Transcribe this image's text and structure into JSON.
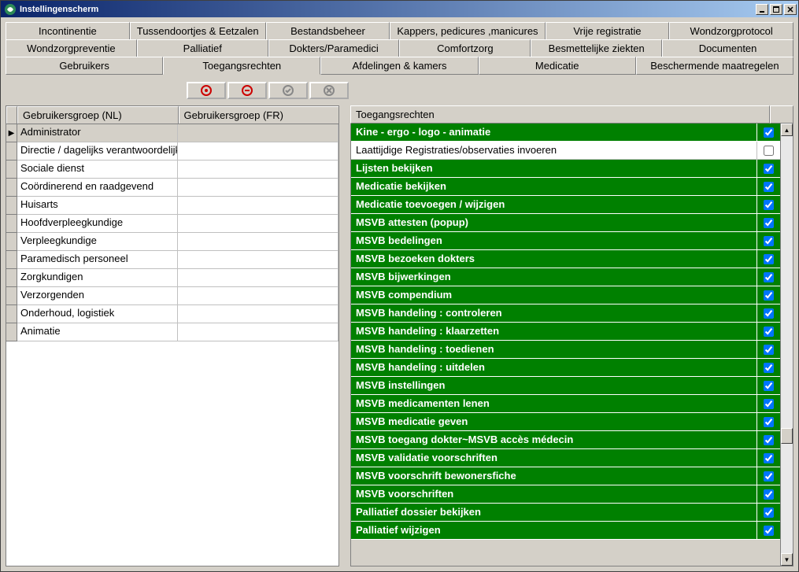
{
  "window": {
    "title": "Instellingenscherm"
  },
  "tabs_row1": [
    "Incontinentie",
    "Tussendoortjes & Eetzalen",
    "Bestandsbeheer",
    "Kappers, pedicures ,manicures",
    "Vrije registratie",
    "Wondzorgprotocol"
  ],
  "tabs_row2": [
    "Wondzorgpreventie",
    "Palliatief",
    "Dokters/Paramedici",
    "Comfortzorg",
    "Besmettelijke ziekten",
    "Documenten"
  ],
  "tabs_row3": [
    "Gebruikers",
    "Toegangsrechten",
    "Afdelingen & kamers",
    "Medicatie",
    "Beschermende maatregelen"
  ],
  "active_tab": "Toegangsrechten",
  "grid": {
    "headers": {
      "nl": "Gebruikersgroep (NL)",
      "fr": "Gebruikersgroep (FR)"
    },
    "rows": [
      {
        "nl": "Administrator",
        "fr": "",
        "selected": true
      },
      {
        "nl": "Directie / dagelijks verantwoordelijke",
        "fr": ""
      },
      {
        "nl": "Sociale dienst",
        "fr": ""
      },
      {
        "nl": "Coördinerend en raadgevend",
        "fr": ""
      },
      {
        "nl": "Huisarts",
        "fr": ""
      },
      {
        "nl": "Hoofdverpleegkundige",
        "fr": ""
      },
      {
        "nl": "Verpleegkundige",
        "fr": ""
      },
      {
        "nl": "Paramedisch personeel",
        "fr": ""
      },
      {
        "nl": "Zorgkundigen",
        "fr": ""
      },
      {
        "nl": "Verzorgenden",
        "fr": ""
      },
      {
        "nl": "Onderhoud, logistiek",
        "fr": ""
      },
      {
        "nl": "Animatie",
        "fr": ""
      }
    ]
  },
  "permissions": {
    "header": "Toegangsrechten",
    "items": [
      {
        "label": "Kine - ergo - logo - animatie",
        "checked": true
      },
      {
        "label": "Laattijdige Registraties/observaties invoeren",
        "checked": false
      },
      {
        "label": "Lijsten bekijken",
        "checked": true
      },
      {
        "label": "Medicatie bekijken",
        "checked": true
      },
      {
        "label": "Medicatie toevoegen / wijzigen",
        "checked": true
      },
      {
        "label": "MSVB attesten (popup)",
        "checked": true
      },
      {
        "label": "MSVB bedelingen",
        "checked": true
      },
      {
        "label": "MSVB bezoeken dokters",
        "checked": true
      },
      {
        "label": "MSVB bijwerkingen",
        "checked": true
      },
      {
        "label": "MSVB compendium",
        "checked": true
      },
      {
        "label": "MSVB handeling : controleren",
        "checked": true
      },
      {
        "label": "MSVB handeling : klaarzetten",
        "checked": true
      },
      {
        "label": "MSVB handeling : toedienen",
        "checked": true
      },
      {
        "label": "MSVB handeling : uitdelen",
        "checked": true
      },
      {
        "label": "MSVB instellingen",
        "checked": true
      },
      {
        "label": "MSVB medicamenten lenen",
        "checked": true
      },
      {
        "label": "MSVB medicatie geven",
        "checked": true
      },
      {
        "label": "MSVB toegang dokter~MSVB accès médecin",
        "checked": true
      },
      {
        "label": "MSVB validatie voorschriften",
        "checked": true
      },
      {
        "label": "MSVB voorschrift bewonersfiche",
        "checked": true
      },
      {
        "label": "MSVB voorschriften",
        "checked": true
      },
      {
        "label": "Palliatief dossier bekijken",
        "checked": true
      },
      {
        "label": "Palliatief wijzigen",
        "checked": true
      }
    ]
  },
  "toolbar_icons": [
    "add",
    "remove",
    "confirm",
    "cancel"
  ]
}
